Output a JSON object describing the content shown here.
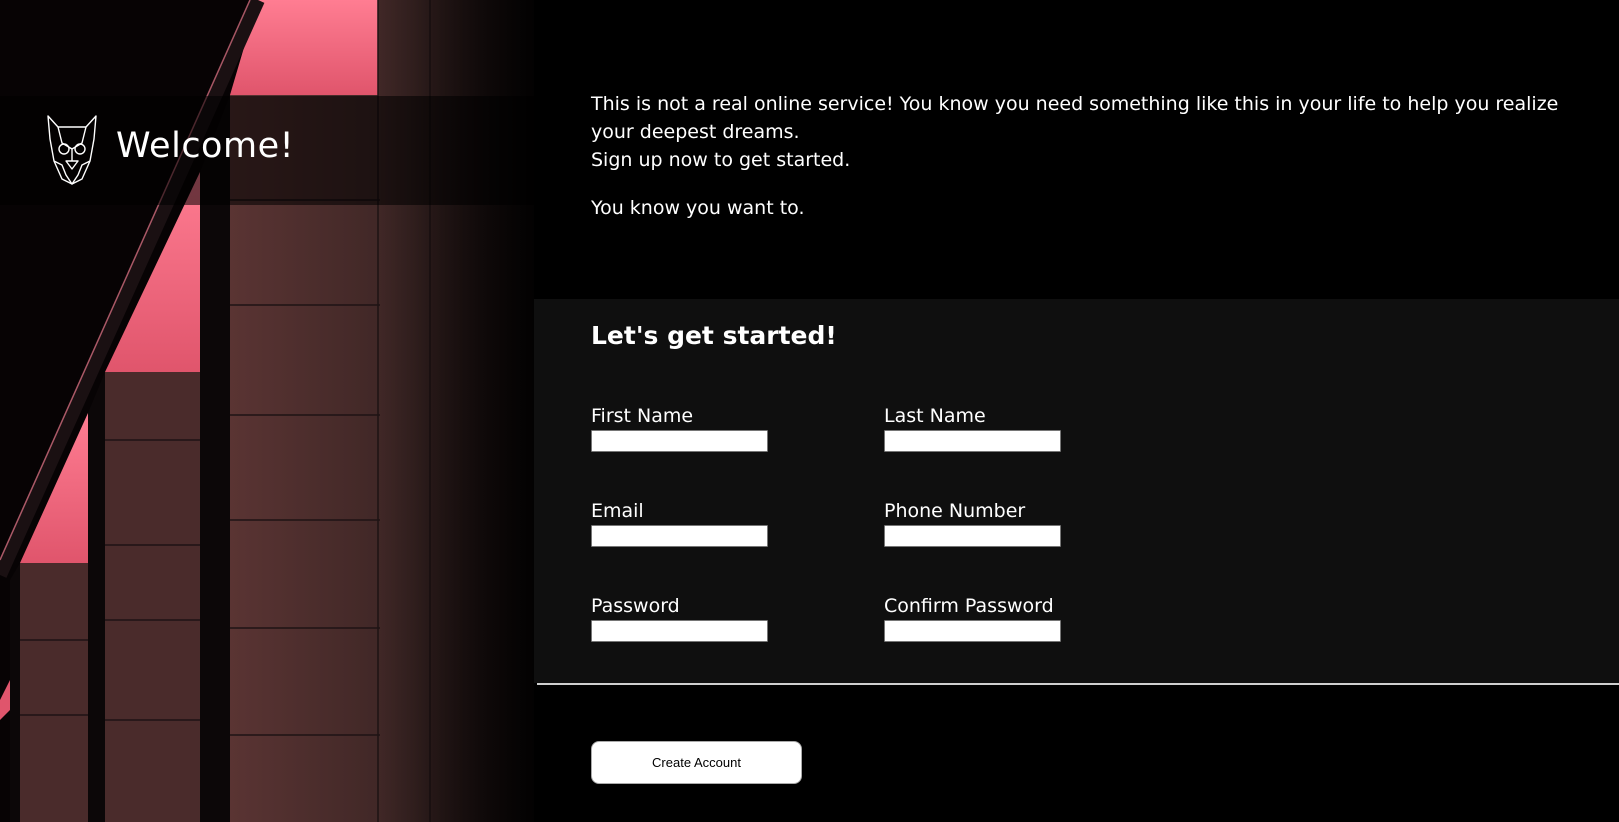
{
  "hero": {
    "logo_icon": "dog-head-logo-icon",
    "welcome_title": "Welcome!"
  },
  "intro": {
    "paragraph_1": "This is not a real online service! You know you need something like this in your life to help you realize your deepest dreams.",
    "paragraph_2": "Sign up now to get started.",
    "paragraph_3": "You know you want to."
  },
  "form": {
    "title": "Let's get started!",
    "fields": [
      {
        "label": "First Name",
        "value": ""
      },
      {
        "label": "Last Name",
        "value": ""
      },
      {
        "label": "Email",
        "value": ""
      },
      {
        "label": "Phone Number",
        "value": ""
      },
      {
        "label": "Password",
        "value": ""
      },
      {
        "label": "Confirm Password",
        "value": ""
      }
    ],
    "submit_label": "Create Account"
  },
  "colors": {
    "background": "#000000",
    "form_background": "#0f0f0f",
    "accent_pink": "#f0607a",
    "text": "#ffffff"
  }
}
